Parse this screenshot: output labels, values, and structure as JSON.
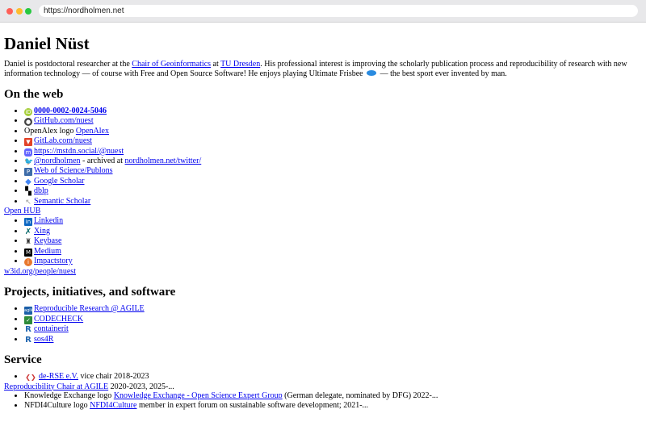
{
  "browser": {
    "url": "https://nordholmen.net"
  },
  "page": {
    "title": "Daniel Nüst",
    "intro": {
      "t1": "Daniel is postdoctoral researcher at the ",
      "chair": "Chair of Geoinformatics",
      "t2": " at ",
      "tud": "TU Dresden",
      "t3": ". His professional interest is improving the scholarly publication process and reproducibility of research with new information technology — of course with Free and Open Source Software! He enjoys playing Ultimate Frisbee",
      "t4": " — the best sport ever invented by man."
    },
    "sections": {
      "web": "On the web",
      "projects": "Projects, initiatives, and software",
      "service": "Service"
    },
    "web": {
      "orcid": "0000-0002-0024-5046",
      "github": "GitHub.com/nuest",
      "openalex_alt": "OpenAlex logo",
      "openalex": "OpenAlex",
      "gitlab": "GitLab.com/nuest",
      "mastodon": "https://mstdn.social/@nuest",
      "twitter": "@nordholmen",
      "twitter_mid": " - archived at ",
      "twitter_archive": "nordholmen.net/twitter/",
      "wos": "Web of Science/Publons",
      "scholar": "Google Scholar",
      "dblp": "dblp",
      "semantic": "Semantic Scholar",
      "openhub": "Open HUB",
      "linkedin": "Linkedin",
      "xing": "Xing",
      "keybase": "Keybase",
      "medium": "Medium",
      "impactstory": "Impactstory",
      "w3id": "w3id.org/people/nuest"
    },
    "projects": {
      "agile": "Reproducible Research @ AGILE",
      "codecheck": "CODECHECK",
      "containerit": "containerit",
      "sos4r": "sos4R"
    },
    "service": {
      "dersee": "de-RSE e.V.",
      "dersee_role": " vice chair 2018-2023",
      "repro": "Reproducibility Chair at AGILE",
      "repro_years": " 2020-2023, 2025-...",
      "ke_alt": "Knowledge Exchange logo",
      "ke": "Knowledge Exchange - Open Science Expert Group",
      "ke_role": " (German delegate, nominated by DFG) 2022-...",
      "nfdi_alt": "NFDI4Culture logo",
      "nfdi": "NFDI4Culture",
      "nfdi_role": " member in expert forum on sustainable software development; 2021-..."
    }
  }
}
